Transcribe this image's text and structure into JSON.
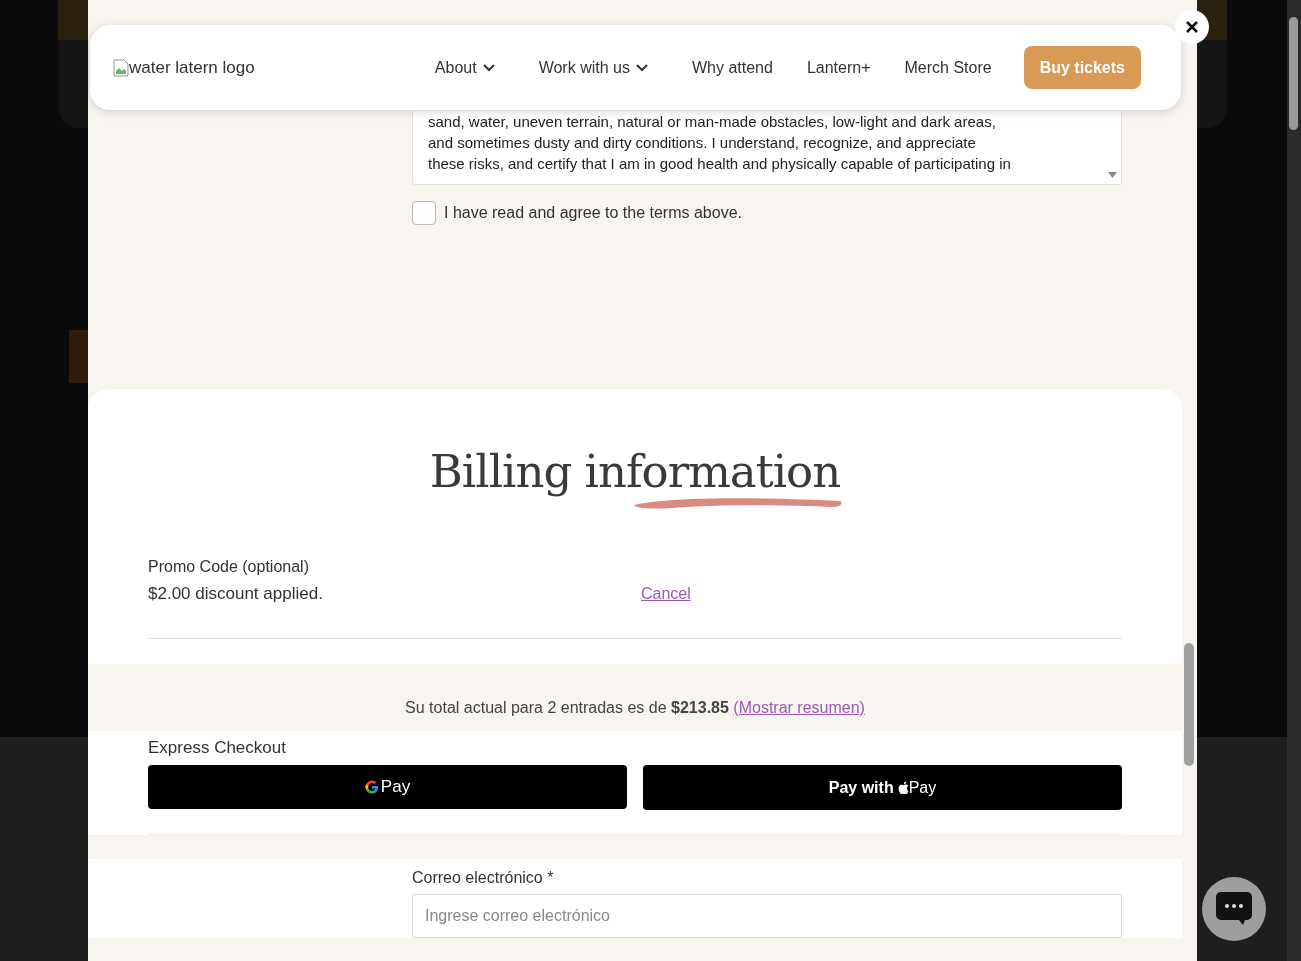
{
  "nav": {
    "logo_alt": "water latern logo",
    "items": [
      {
        "label": "About",
        "dropdown": true
      },
      {
        "label": "Work with us",
        "dropdown": true
      },
      {
        "label": "Why attend",
        "dropdown": false
      },
      {
        "label": "Lantern+",
        "dropdown": false
      },
      {
        "label": "Merch Store",
        "dropdown": false
      }
    ],
    "cta": "Buy tickets"
  },
  "waiver": {
    "lines": [
      "sand, water, uneven terrain, natural or man-made obstacles, low-light and dark areas,",
      "and sometimes dusty and dirty conditions. I understand, recognize, and appreciate",
      "these risks, and certify that I am in good health and physically capable of participating in"
    ],
    "agree": {
      "label": "I have read and agree to the terms above.",
      "checked": false
    }
  },
  "billing": {
    "title": "Billing information"
  },
  "promo": {
    "label": "Promo Code (optional)",
    "status": "$2.00 discount applied.",
    "cancel": "Cancel"
  },
  "total": {
    "text": "Su total actual para 2 entradas es de **$213.85**",
    "summary_link": "(Mostrar resumen)"
  },
  "express": {
    "label": "Express Checkout",
    "buttons": [
      {
        "kind": "google",
        "texts": [
          "Pay"
        ]
      },
      {
        "kind": "apple",
        "texts": [
          "Pay with",
          "Pay"
        ]
      }
    ]
  },
  "email": {
    "label": "Correo electrónico *",
    "placeholder": "Ingrese correo electrónico"
  }
}
